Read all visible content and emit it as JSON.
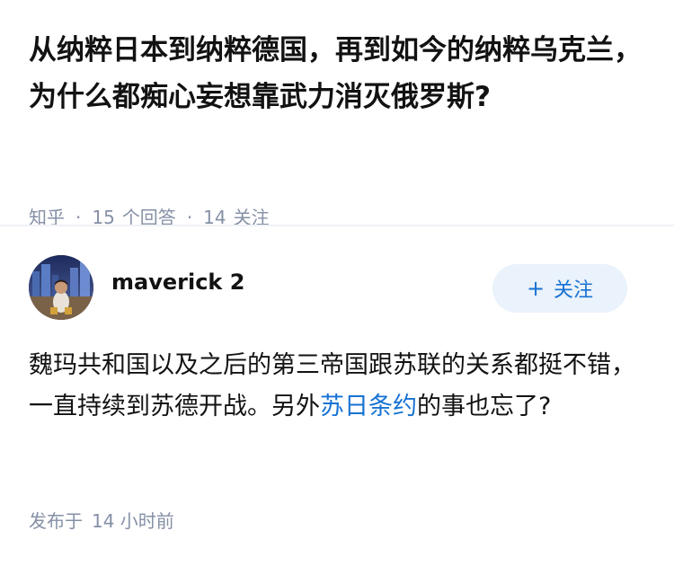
{
  "question": {
    "title": "从纳粹日本到纳粹德国，再到如今的纳粹乌克兰，为什么都痴心妄想靠武力消灭俄罗斯?",
    "source": "知乎",
    "answer_count": "15",
    "answer_label": "个回答",
    "follower_count": "14",
    "follower_label": "关注",
    "separator": "·"
  },
  "answer": {
    "author": {
      "name": "maverick 2",
      "avatar_icon": "user-avatar-photo"
    },
    "follow_button": {
      "icon": "+",
      "label": "关注"
    },
    "content": {
      "part1": "魏玛共和国以及之后的第三帝国跟苏联的关系都挺不错，一直持续到苏德开战。另外",
      "link": "苏日条约",
      "part2": "的事也忘了?"
    },
    "publish_label": "发布于",
    "publish_time": "14 小时前"
  },
  "colors": {
    "text": "#121212",
    "meta": "#8590a6",
    "accent": "#1772d3",
    "button_bg": "#eaf2fb"
  }
}
